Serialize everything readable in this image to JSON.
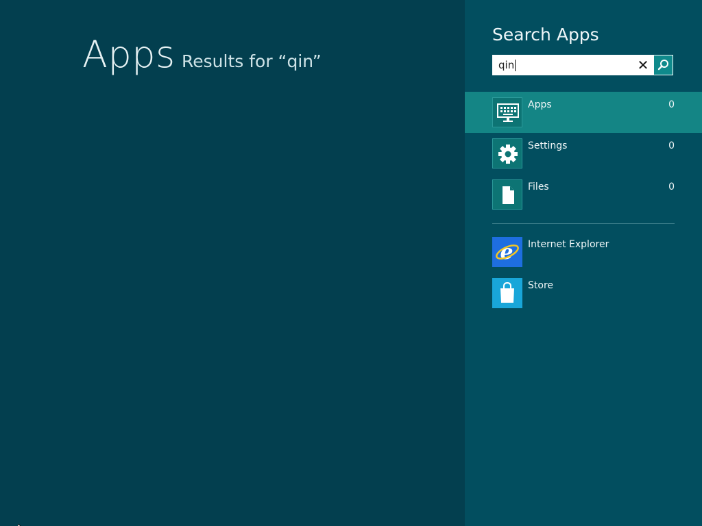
{
  "main": {
    "title": "Apps",
    "results_for": "Results for “qin”"
  },
  "search_pane": {
    "title": "Search Apps",
    "query": "qin",
    "clear_icon": "close-icon",
    "search_icon": "search-icon",
    "categories": [
      {
        "label": "Apps",
        "count": "0",
        "icon": "keyboard-monitor-icon",
        "selected": true
      },
      {
        "label": "Settings",
        "count": "0",
        "icon": "gear-icon",
        "selected": false
      },
      {
        "label": "Files",
        "count": "0",
        "icon": "file-icon",
        "selected": false
      }
    ],
    "apps": [
      {
        "label": "Internet Explorer",
        "icon": "internet-explorer-icon",
        "color": "#1e6ee0"
      },
      {
        "label": "Store",
        "icon": "store-bag-icon",
        "color": "#19a6d9"
      }
    ]
  },
  "colors": {
    "background": "#033f4f",
    "pane": "#024e5f",
    "selected": "#148585",
    "accent": "#0f8a8c"
  }
}
